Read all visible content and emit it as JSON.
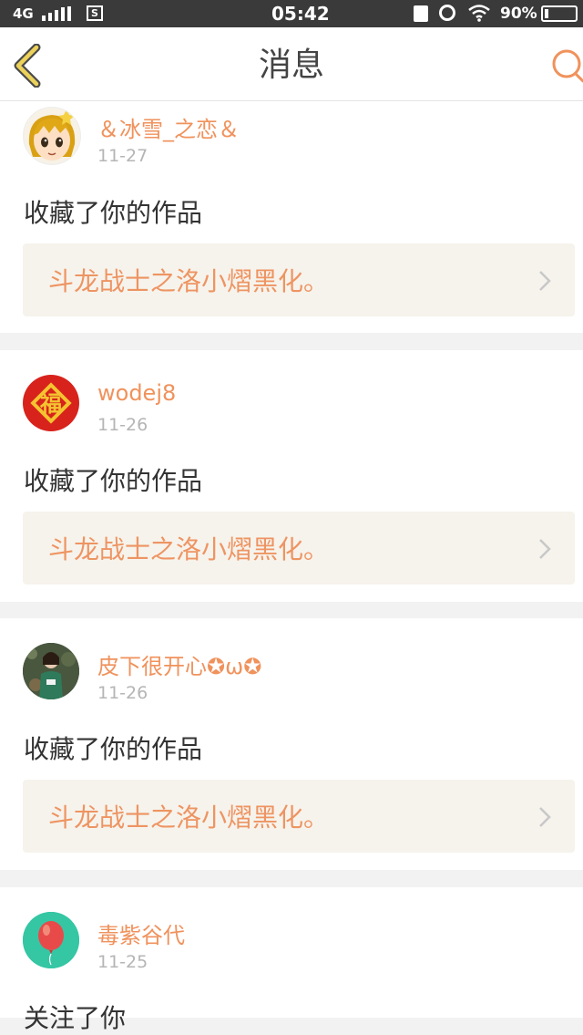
{
  "status_bar": {
    "network": "4G",
    "time": "05:42",
    "battery": "90%"
  },
  "header": {
    "title": "消息"
  },
  "colors": {
    "accent": "#f0925c",
    "header_back": "#e8c84a"
  },
  "messages": [
    {
      "user": "＆冰雪_之恋＆",
      "date": "11-27",
      "action": "收藏了你的作品",
      "work": "斗龙战士之洛小熠黑化。",
      "avatar_icon": "cartoon-girl-avatar"
    },
    {
      "user": "wodej8",
      "date": "11-26",
      "action": "收藏了你的作品",
      "work": "斗龙战士之洛小熠黑化。",
      "avatar_icon": "fu-character-avatar",
      "avatar_text": "福"
    },
    {
      "user": "皮下很开心✪ω✪",
      "date": "11-26",
      "action": "收藏了你的作品",
      "work": "斗龙战士之洛小熠黑化。",
      "avatar_icon": "photo-avatar"
    },
    {
      "user": "毒紫谷代",
      "date": "11-25",
      "action": "关注了你",
      "avatar_icon": "balloon-avatar"
    }
  ]
}
